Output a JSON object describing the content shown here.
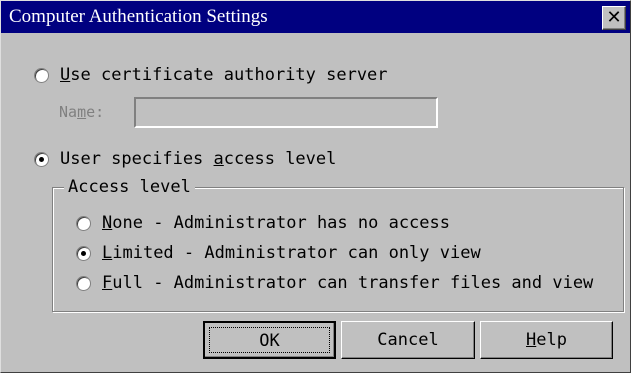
{
  "window": {
    "title": "Computer Authentication Settings",
    "close_glyph": "✕"
  },
  "options": {
    "ca_server": {
      "prefix": "",
      "mnemonic": "U",
      "rest": "se certificate authority server",
      "checked": false
    },
    "name_label_pre": "Na",
    "name_label_mn": "m",
    "name_label_post": "e:",
    "name_value": "",
    "user_specifies": {
      "prefix": "User specifies ",
      "mnemonic": "a",
      "rest": "ccess level",
      "checked": true
    }
  },
  "access_level": {
    "group_label": "Access level",
    "items": [
      {
        "mnemonic": "N",
        "rest": "one - Administrator has no access",
        "checked": false
      },
      {
        "mnemonic": "L",
        "rest": "imited - Administrator can only view",
        "checked": true
      },
      {
        "mnemonic": "F",
        "rest": "ull - Administrator can transfer files and view",
        "checked": false
      }
    ]
  },
  "buttons": {
    "ok": "OK",
    "cancel": "Cancel",
    "help_mnemonic": "H",
    "help_rest": "elp"
  }
}
